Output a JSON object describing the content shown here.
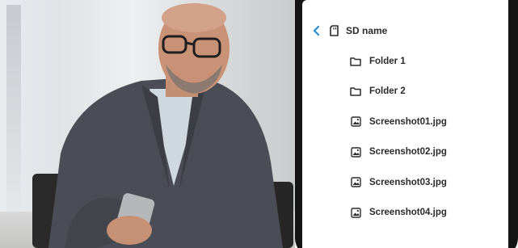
{
  "header": {
    "title": "SD name",
    "back_icon": "chevron-left-icon",
    "storage_icon": "sd-card-icon",
    "accent": "#2a8fd4"
  },
  "items": [
    {
      "label": "Folder 1",
      "icon": "folder-icon"
    },
    {
      "label": "Folder 2",
      "icon": "folder-icon"
    },
    {
      "label": "Screenshot01.jpg",
      "icon": "image-file-icon"
    },
    {
      "label": "Screenshot02.jpg",
      "icon": "image-file-icon"
    },
    {
      "label": "Screenshot03.jpg",
      "icon": "image-file-icon"
    },
    {
      "label": "Screenshot04.jpg",
      "icon": "image-file-icon"
    }
  ]
}
